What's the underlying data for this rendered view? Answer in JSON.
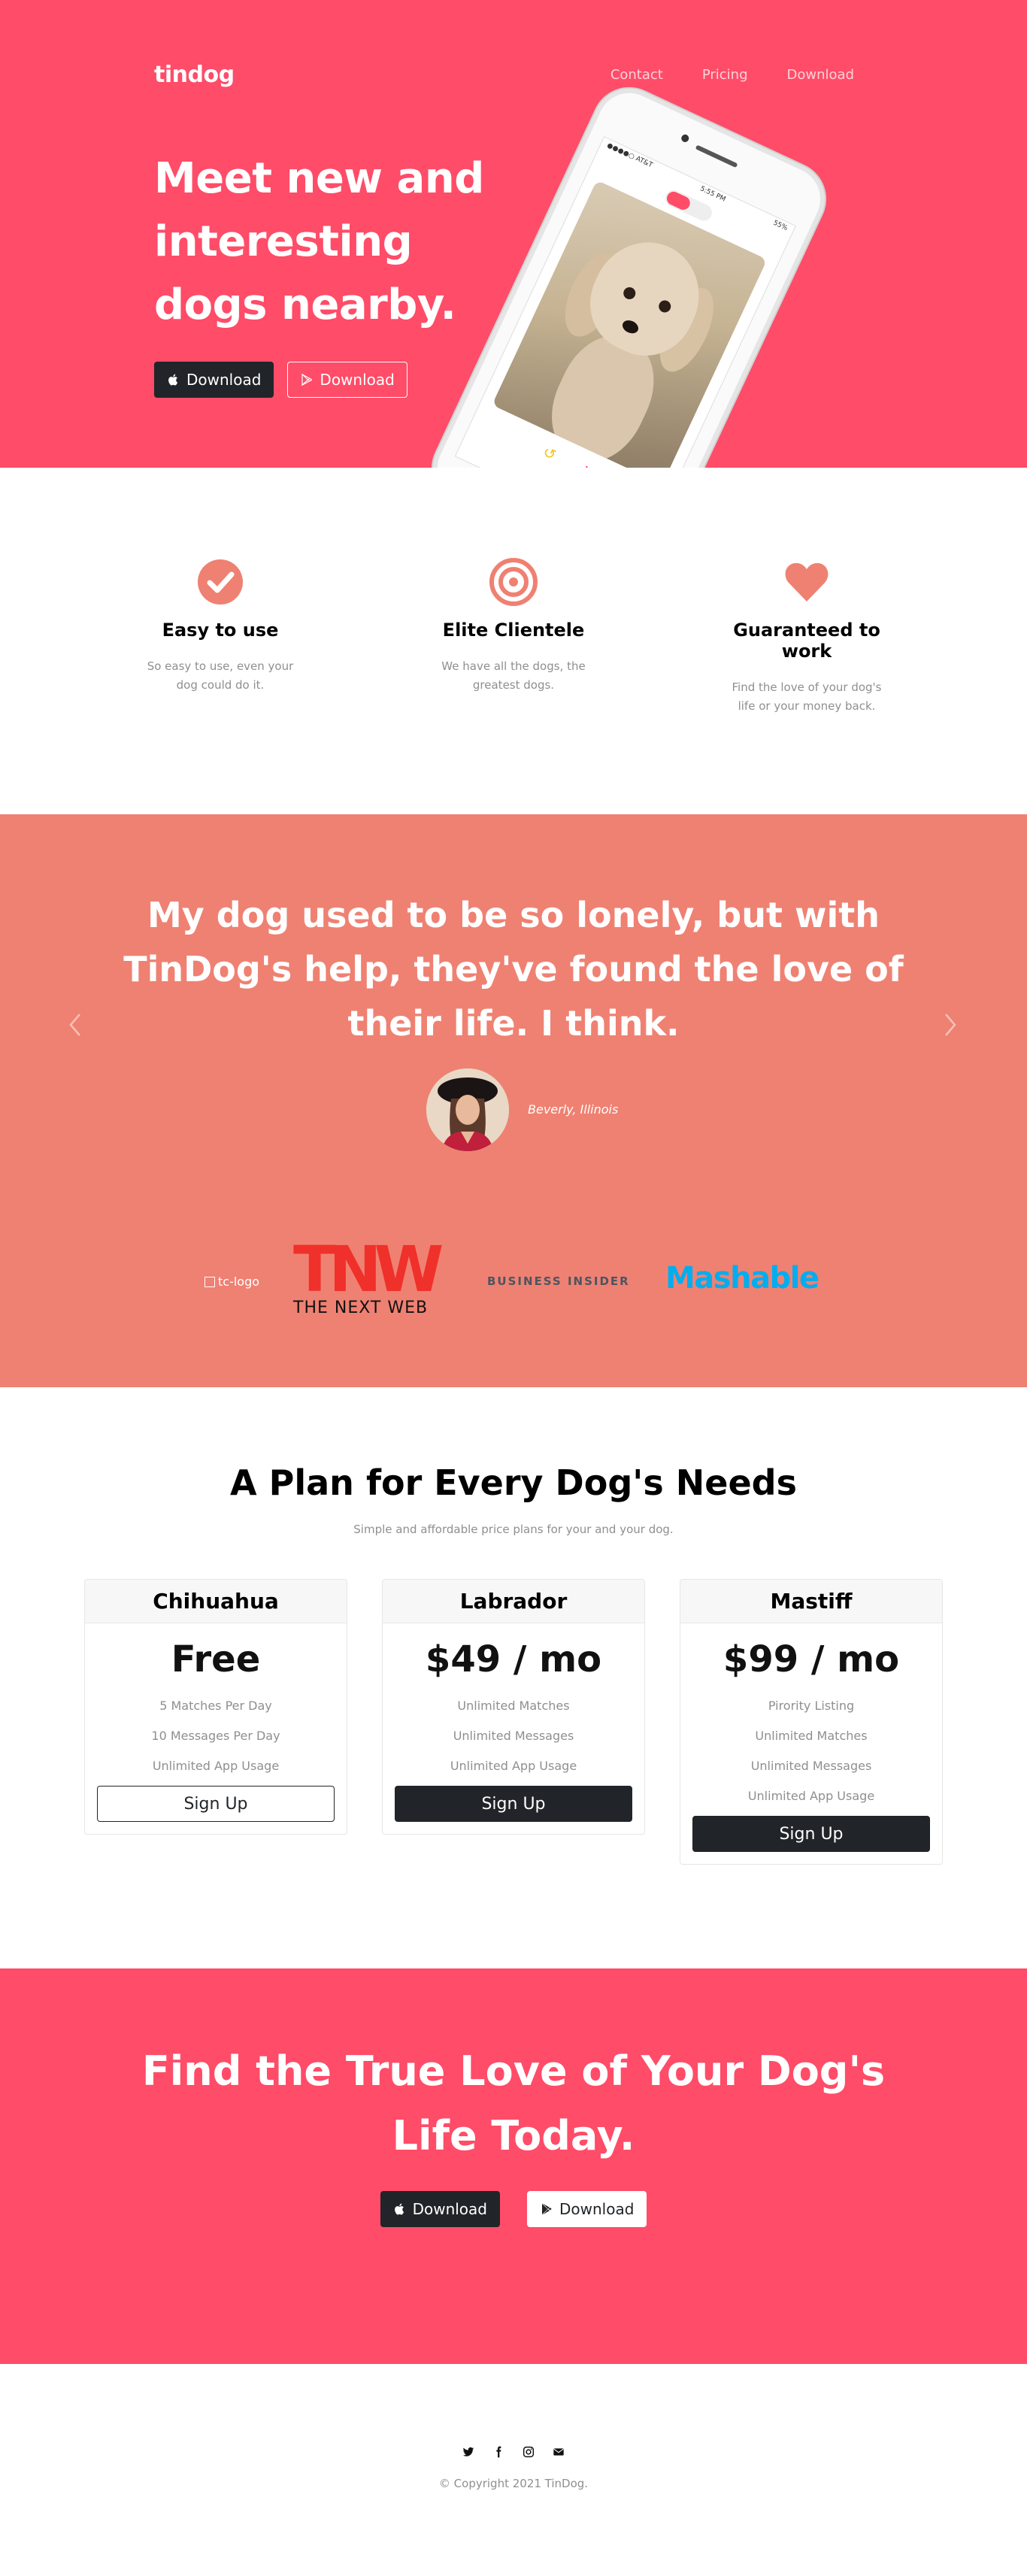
{
  "colors": {
    "primary": "#ff4c68",
    "secondary": "#ef8172",
    "dark": "#212529"
  },
  "navbar": {
    "brand": "tindog",
    "links": [
      {
        "label": "Contact"
      },
      {
        "label": "Pricing"
      },
      {
        "label": "Download"
      }
    ]
  },
  "hero": {
    "title": "Meet new and interesting dogs nearby.",
    "buttons": [
      {
        "label": "Download",
        "icon": "apple-icon"
      },
      {
        "label": "Download",
        "icon": "google-play-icon"
      }
    ]
  },
  "features": [
    {
      "icon": "check-circle-icon",
      "title": "Easy to use",
      "text": "So easy to use, even your dog could do it."
    },
    {
      "icon": "bullseye-icon",
      "title": "Elite Clientele",
      "text": "We have all the dogs, the greatest dogs."
    },
    {
      "icon": "heart-icon",
      "title": "Guaranteed to work",
      "text": "Find the love of your dog's life or your money back."
    }
  ],
  "testimonial": {
    "quote": "My dog used to be so lonely, but with TinDog's help, they've found the love of their life. I think.",
    "author": "Beverly, Illinois"
  },
  "press": {
    "tc_alt": "tc-logo",
    "tnw_mark": "TNW",
    "tnw_text": "THE NEXT WEB",
    "business_insider": "BUSINESS INSIDER",
    "mashable": "Mashable"
  },
  "pricing": {
    "title": "A Plan for Every Dog's Needs",
    "subtitle": "Simple and affordable price plans for your and your dog.",
    "plans": [
      {
        "name": "Chihuahua",
        "price": "Free",
        "features": [
          "5 Matches Per Day",
          "10 Messages Per Day",
          "Unlimited App Usage"
        ],
        "button": "Sign Up"
      },
      {
        "name": "Labrador",
        "price": "$49 / mo",
        "features": [
          "Unlimited Matches",
          "Unlimited Messages",
          "Unlimited App Usage"
        ],
        "button": "Sign Up"
      },
      {
        "name": "Mastiff",
        "price": "$99 / mo",
        "features": [
          "Pirority Listing",
          "Unlimited Matches",
          "Unlimited Messages",
          "Unlimited App Usage"
        ],
        "button": "Sign Up"
      }
    ]
  },
  "cta": {
    "title": "Find the True Love of Your Dog's Life Today.",
    "buttons": [
      {
        "label": "Download",
        "icon": "apple-icon"
      },
      {
        "label": "Download",
        "icon": "google-play-icon"
      }
    ]
  },
  "footer": {
    "social": [
      "twitter-icon",
      "facebook-icon",
      "instagram-icon",
      "envelope-icon"
    ],
    "copyright": "© Copyright 2021 TinDog."
  }
}
